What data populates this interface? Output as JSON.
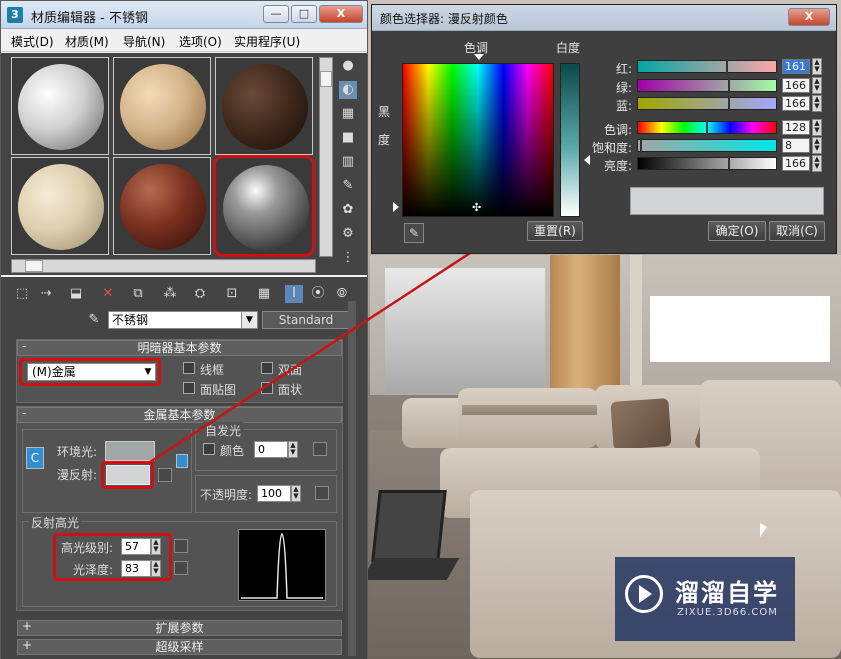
{
  "material_editor": {
    "title": "材质编辑器 - 不锈钢",
    "window_buttons": {
      "minimize": "—",
      "maximize": "□",
      "close": "X"
    },
    "menu": [
      "模式(D)",
      "材质(M)",
      "导航(N)",
      "选项(O)",
      "实用程序(U)"
    ],
    "material_name": "不锈钢",
    "material_type": "Standard",
    "shader_rollout": {
      "title": "明暗器基本参数",
      "shader": "(M)金属",
      "options": {
        "wire": "线框",
        "two_sided": "双面",
        "face_map": "面贴图",
        "faceted": "面状"
      }
    },
    "metal_rollout": {
      "title": "金属基本参数",
      "ambient_label": "环境光:",
      "diffuse_label": "漫反射:",
      "lock_label": "C",
      "self_illum": {
        "group": "自发光",
        "color_label": "颜色",
        "value": "0"
      },
      "opacity": {
        "label": "不透明度:",
        "value": "100"
      }
    },
    "specular": {
      "group": "反射高光",
      "level_label": "高光级别:",
      "level_value": "57",
      "gloss_label": "光泽度:",
      "gloss_value": "83"
    },
    "collapsed_rollouts": {
      "expand": "+",
      "extended": "扩展参数",
      "supersampling": "超级采样"
    }
  },
  "color_picker": {
    "title": "颜色选择器: 漫反射颜色",
    "close": "X",
    "hue_label": "色调",
    "whiteness_label": "白度",
    "black_label_1": "黑",
    "black_label_2": "度",
    "channels": [
      {
        "label": "红:",
        "value": "161"
      },
      {
        "label": "绿:",
        "value": "166"
      },
      {
        "label": "蓝:",
        "value": "166"
      },
      {
        "label": "色调:",
        "value": "128"
      },
      {
        "label": "饱和度:",
        "value": "8"
      },
      {
        "label": "亮度:",
        "value": "166"
      }
    ],
    "reset": "重置(R)",
    "ok": "确定(O)",
    "cancel": "取消(C)",
    "current_color": "#a1a6a6"
  },
  "watermark": {
    "brand": "溜溜自学",
    "url": "ZIXUE.3D66.COM"
  }
}
